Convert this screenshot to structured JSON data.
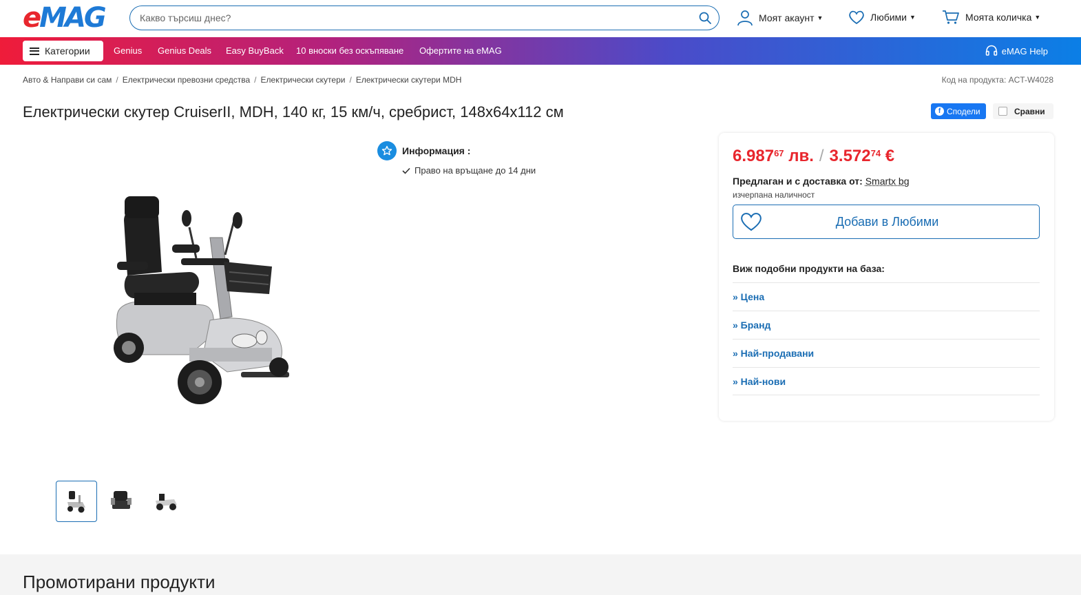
{
  "header": {
    "logo_e": "e",
    "logo_mag": "MAG",
    "search_placeholder": "Какво търсиш днес?",
    "account_label": "Моят акаунт",
    "favorites_label": "Любими",
    "cart_label": "Моята количка"
  },
  "nav": {
    "categories_label": "Категории",
    "items": [
      "Genius",
      "Genius Deals",
      "Easy BuyBack",
      "10 вноски без оскъпяване",
      "Офертите на eMAG"
    ],
    "help_label": "eMAG Help"
  },
  "breadcrumb": [
    "Авто & Направи си сам",
    "Електрически превозни средства",
    "Електрически скутери",
    "Електрически скутери MDH"
  ],
  "product_code": "Код на продукта: ACT-W4028",
  "product": {
    "title": "Електрически скутер CruiserII, MDH, 140 кг, 15 км/ч, сребрист, 148x64x112 см",
    "share_label": "Сподели",
    "compare_label": "Сравни"
  },
  "info": {
    "heading": "Информация :",
    "items": [
      "Право на връщане до 14 дни"
    ]
  },
  "price_panel": {
    "price_bgn_int": "6.987",
    "price_bgn_dec": "67",
    "price_bgn_cur": "лв.",
    "price_separator": "/",
    "price_eur_int": "3.572",
    "price_eur_dec": "74",
    "price_eur_cur": "€",
    "seller_prefix": "Предлаган и с доставка от:",
    "seller_name": "Smartx bg",
    "stock_status": "изчерпана наличност",
    "favorite_button": "Добави в Любими",
    "similar_heading": "Виж подобни продукти на база:",
    "similar_items": [
      "» Цена",
      "» Бранд",
      "» Най-продавани",
      "» Най-нови"
    ]
  },
  "promoted": {
    "title": "Промотирани продукти"
  },
  "colors": {
    "brand_red": "#e8262d",
    "brand_blue": "#1a6db3",
    "price_red": "#e8262d"
  }
}
